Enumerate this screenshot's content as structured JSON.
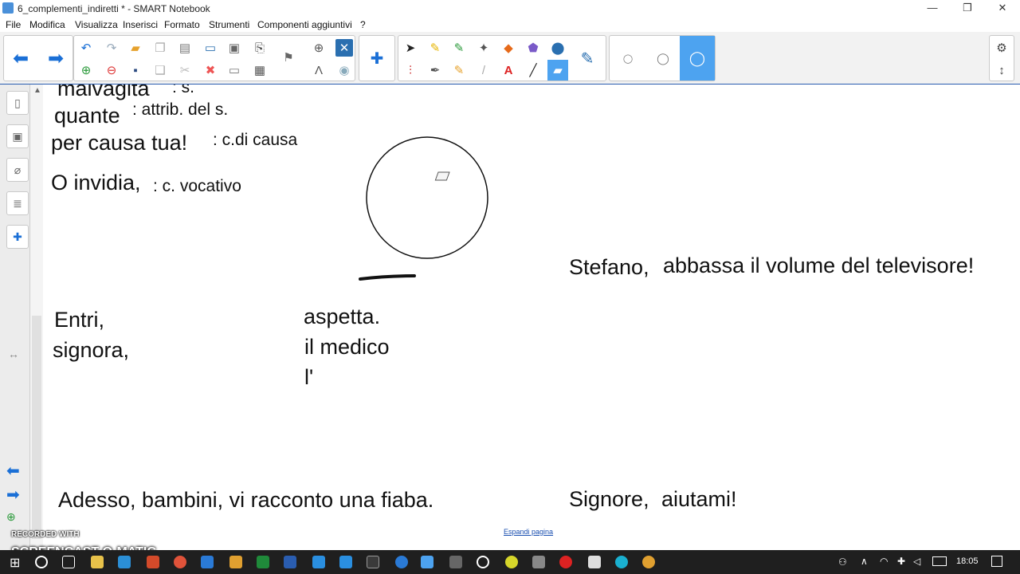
{
  "window": {
    "title": "6_complementi_indiretti * - SMART Notebook",
    "minimize": "—",
    "restore": "❐",
    "close": "✕"
  },
  "menu": [
    "File",
    "Modifica",
    "Visualizza",
    "Inserisci",
    "Formato",
    "Strumenti",
    "Componenti aggiuntivi",
    "?"
  ],
  "canvas": {
    "lines": [
      {
        "text": "malvagità",
        "size": "big"
      },
      {
        "text": ": s.",
        "size": "small"
      },
      {
        "text": "quante",
        "size": "big"
      },
      {
        "text": ": attrib. del s.",
        "size": "small"
      },
      {
        "text": "per causa tua!",
        "size": "big"
      },
      {
        "text": ": c.di causa",
        "size": "small"
      },
      {
        "text": "O invidia,",
        "size": "big"
      },
      {
        "text": ": c. vocativo",
        "size": "small"
      },
      {
        "text": "Entri,",
        "size": "big"
      },
      {
        "text": "signora,",
        "size": "big"
      },
      {
        "text": "aspetta.",
        "size": "big"
      },
      {
        "text": "il medico",
        "size": "big"
      },
      {
        "text": "l'",
        "size": "big"
      },
      {
        "text": "Stefano,",
        "size": "big"
      },
      {
        "text": "abbassa il volume del televisore!",
        "size": "big"
      },
      {
        "text": "Adesso, bambini, vi racconto una fiaba.",
        "size": "big"
      },
      {
        "text": "Signore,",
        "size": "big"
      },
      {
        "text": "aiutami!",
        "size": "big"
      },
      {
        "text": "Espandi pagina",
        "size": "link"
      }
    ]
  },
  "watermark": {
    "top": "RECORDED WITH",
    "brand": "SCREENCAST-O-MATIC"
  },
  "taskbar": {
    "time": "18:05"
  },
  "colors": {
    "accent": "#2a5db0",
    "arrow_blue": "#1a6fd6",
    "selected_tool": "#4da3f0"
  }
}
